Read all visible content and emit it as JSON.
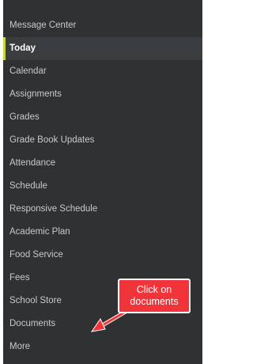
{
  "nav": {
    "items": [
      {
        "label": "Message Center",
        "active": false
      },
      {
        "label": "Today",
        "active": true
      },
      {
        "label": "Calendar",
        "active": false
      },
      {
        "label": "Assignments",
        "active": false
      },
      {
        "label": "Grades",
        "active": false
      },
      {
        "label": "Grade Book Updates",
        "active": false
      },
      {
        "label": "Attendance",
        "active": false
      },
      {
        "label": "Schedule",
        "active": false
      },
      {
        "label": "Responsive Schedule",
        "active": false
      },
      {
        "label": "Academic Plan",
        "active": false
      },
      {
        "label": "Food Service",
        "active": false
      },
      {
        "label": "Fees",
        "active": false
      },
      {
        "label": "School Store",
        "active": false
      },
      {
        "label": "Documents",
        "active": false
      },
      {
        "label": "More",
        "active": false
      }
    ]
  },
  "callout": {
    "line1": "Click on",
    "line2": "documents"
  },
  "colors": {
    "sidebar_bg": "#2f3133",
    "active_bg": "#3a3d40",
    "active_indicator": "#c9d63a",
    "callout": "#f0343a"
  }
}
